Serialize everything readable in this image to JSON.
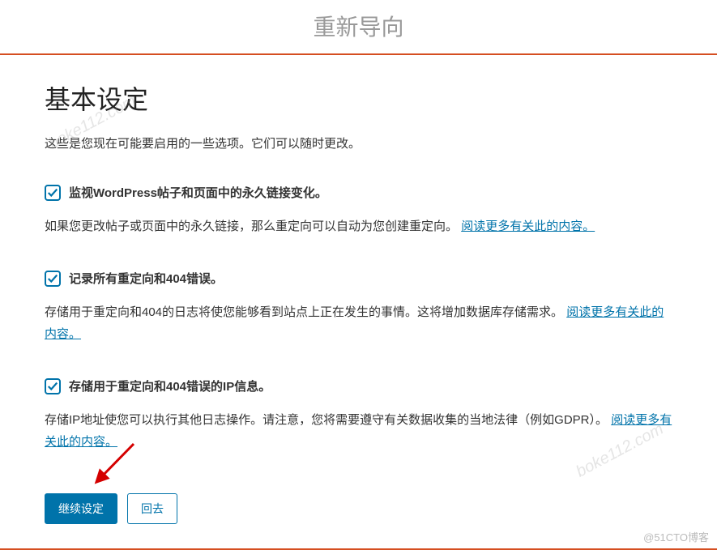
{
  "page": {
    "title": "重新导向"
  },
  "heading": "基本设定",
  "intro": "这些是您现在可能要启用的一些选项。它们可以随时更改。",
  "options": [
    {
      "label": "监视WordPress帖子和页面中的永久链接变化。",
      "desc_prefix": "如果您更改帖子或页面中的永久链接，那么重定向可以自动为您创建重定向。",
      "link": "阅读更多有关此的内容。"
    },
    {
      "label": "记录所有重定向和404错误。",
      "desc_prefix": "存储用于重定向和404的日志将使您能够看到站点上正在发生的事情。这将增加数据库存储需求。",
      "link": "阅读更多有关此的内容。"
    },
    {
      "label": "存储用于重定向和404错误的IP信息。",
      "desc_prefix": "存储IP地址使您可以执行其他日志操作。请注意，您将需要遵守有关数据收集的当地法律（例如GDPR）。",
      "link": "阅读更多有关此的内容。"
    }
  ],
  "buttons": {
    "continue": "继续设定",
    "back": "回去"
  },
  "watermark": "boke112.com",
  "credit": "@51CTO博客"
}
